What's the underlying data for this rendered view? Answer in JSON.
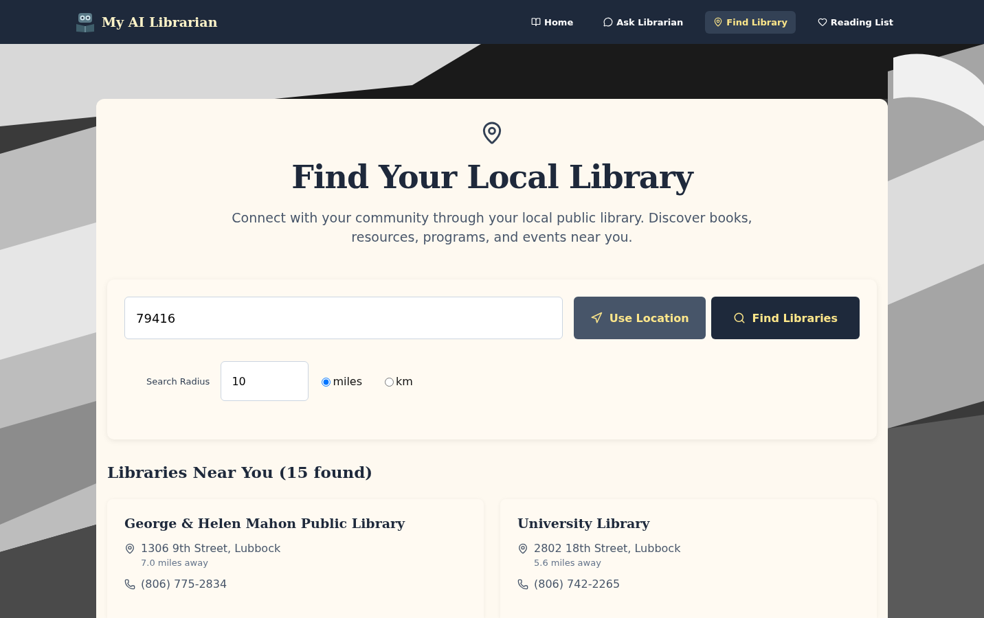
{
  "brand": {
    "name": "My AI Librarian"
  },
  "nav": [
    {
      "label": "Home",
      "kind": "book",
      "selected": false
    },
    {
      "label": "Ask Librarian",
      "kind": "chat",
      "selected": false
    },
    {
      "label": "Find Library",
      "kind": "pin",
      "selected": true
    },
    {
      "label": "Reading List",
      "kind": "heart",
      "selected": false
    }
  ],
  "hero": {
    "title": "Find Your Local Library",
    "subtitle": "Connect with your community through your local public library. Discover books, resources, programs, and events near you."
  },
  "search": {
    "value": "79416",
    "use_location": "Use Location",
    "find": "Find Libraries",
    "radius_label": "Search Radius",
    "radius_value": "10",
    "units": [
      {
        "label": "miles",
        "selected": true
      },
      {
        "label": "km",
        "selected": false
      }
    ]
  },
  "results": {
    "heading": "Libraries Near You (15 found)",
    "libraries": [
      {
        "name": "George & Helen Mahon Public Library",
        "address": "1306 9th Street, Lubbock",
        "distance": "7.0 miles away",
        "phone": "(806) 775-2834"
      },
      {
        "name": "University Library",
        "address": "2802 18th Street, Lubbock",
        "distance": "5.6 miles away",
        "phone": "(806) 742-2265"
      }
    ]
  }
}
